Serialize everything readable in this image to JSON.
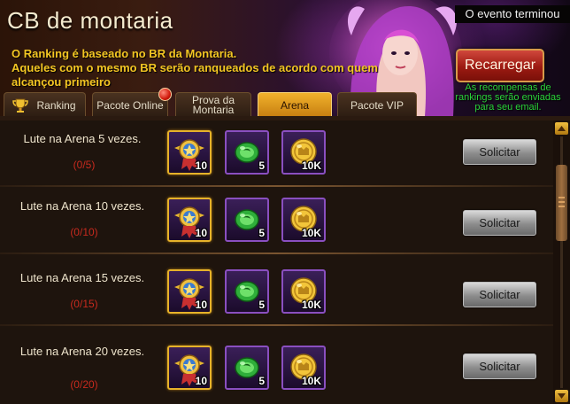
{
  "header": {
    "title": "CB de montaria",
    "description_lines": [
      "O Ranking é baseado no BR da Montaria.",
      "Aqueles com o mesmo BR serão ranqueados de acordo com quem",
      "alcançou primeiro"
    ],
    "event_status": "O evento terminou",
    "recharge_button": "Recarregar",
    "reward_note_lines": [
      "As  recompensas de",
      "rankings serão enviadas",
      "para seu email."
    ]
  },
  "tabs": [
    {
      "label": "Ranking",
      "icon": "trophy-icon",
      "active": false
    },
    {
      "label": "Pacote Online",
      "badge": true,
      "active": false
    },
    {
      "label": "Prova da Montaria",
      "active": false
    },
    {
      "label": "Arena",
      "active": true
    },
    {
      "label": "Pacote VIP",
      "active": false
    }
  ],
  "tasks": [
    {
      "text": "Lute na Arena 5 vezes.",
      "progress": "(0/5)",
      "rewards": [
        {
          "icon": "medal-icon",
          "qty": "10"
        },
        {
          "icon": "green-orb-icon",
          "qty": "5"
        },
        {
          "icon": "gold-coin-icon",
          "qty": "10K"
        }
      ],
      "button": "Solicitar"
    },
    {
      "text": "Lute na Arena 10 vezes.",
      "progress": "(0/10)",
      "rewards": [
        {
          "icon": "medal-icon",
          "qty": "10"
        },
        {
          "icon": "green-orb-icon",
          "qty": "5"
        },
        {
          "icon": "gold-coin-icon",
          "qty": "10K"
        }
      ],
      "button": "Solicitar"
    },
    {
      "text": "Lute na Arena 15 vezes.",
      "progress": "(0/15)",
      "rewards": [
        {
          "icon": "medal-icon",
          "qty": "10"
        },
        {
          "icon": "green-orb-icon",
          "qty": "5"
        },
        {
          "icon": "gold-coin-icon",
          "qty": "10K"
        }
      ],
      "button": "Solicitar"
    },
    {
      "text": "Lute na Arena 20 vezes.",
      "progress": "(0/20)",
      "rewards": [
        {
          "icon": "medal-icon",
          "qty": "10"
        },
        {
          "icon": "green-orb-icon",
          "qty": "5"
        },
        {
          "icon": "gold-coin-icon",
          "qty": "10K"
        }
      ],
      "button": "Solicitar"
    }
  ],
  "colors": {
    "title_text": "#f6ecd0",
    "description_text": "#f3c623",
    "reward_note_text": "#2bd43a",
    "progress_text": "#c72a1e",
    "active_tab": "#f1b22c",
    "recharge_button": "#b0241a"
  }
}
